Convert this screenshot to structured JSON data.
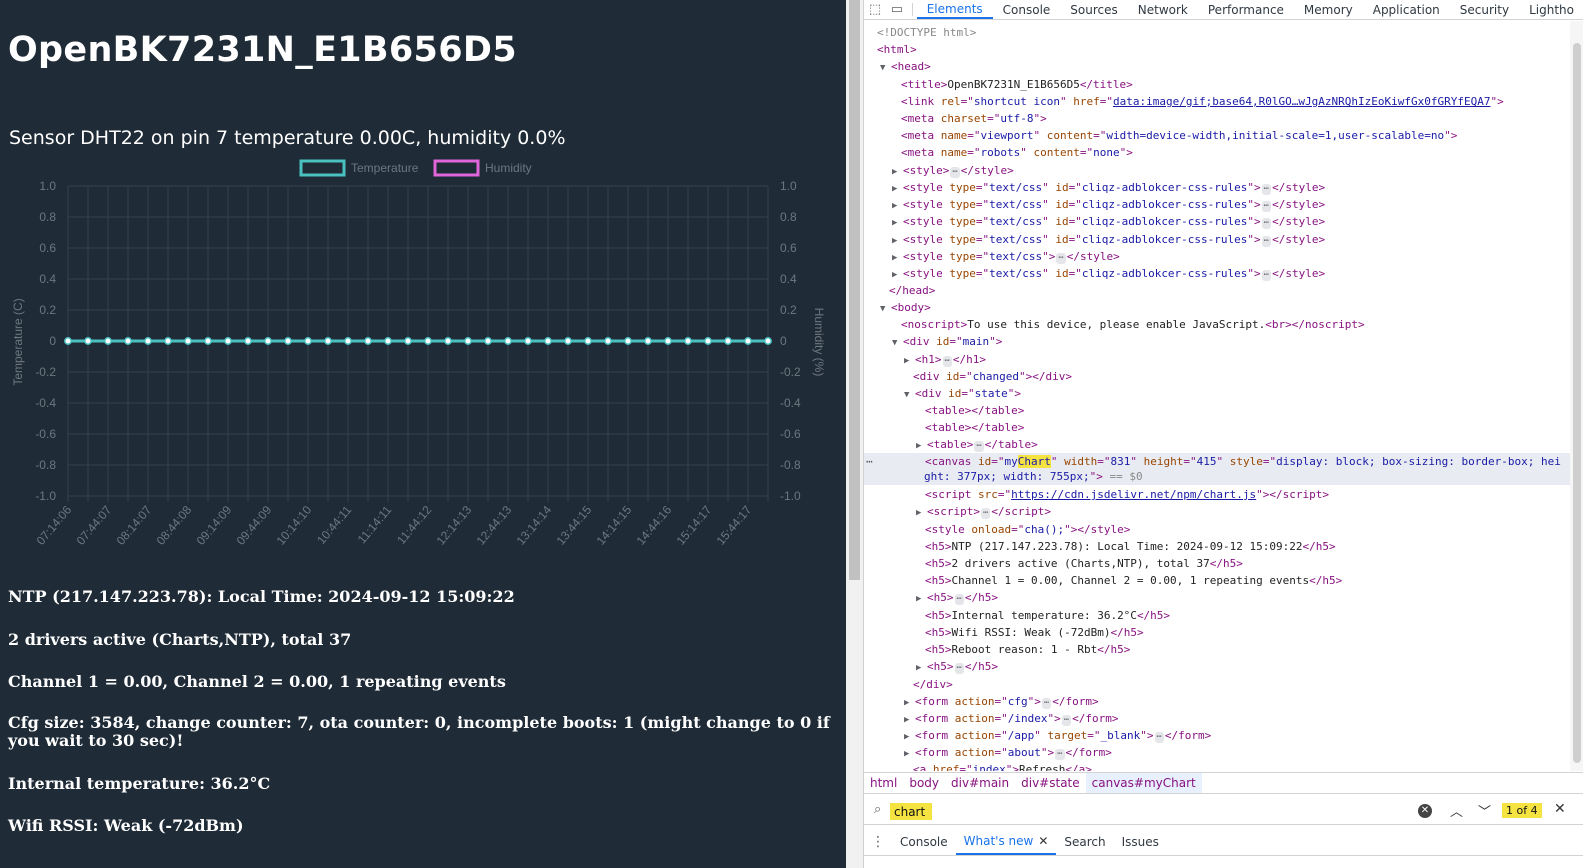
{
  "page": {
    "title": "OpenBK7231N_E1B656D5",
    "chart_heading": "Sensor DHT22 on pin 7 temperature 0.00C, humidity 0.0%",
    "info_lines": [
      "NTP (217.147.223.78): Local Time: 2024-09-12 15:09:22",
      "2 drivers active (Charts,NTP), total 37",
      "Channel 1 = 0.00, Channel 2 = 0.00, 1 repeating events",
      "Cfg size: 3584, change counter: 7, ota counter: 0, incomplete boots: 1 (might change to 0 if you wait to 30 sec)!",
      "Internal temperature: 36.2°C",
      "Wifi RSSI: Weak (-72dBm)"
    ]
  },
  "chart_data": {
    "type": "line",
    "title": "",
    "categories": [
      "07:14:06",
      "07:44:07",
      "08:14:07",
      "08:44:08",
      "09:14:09",
      "09:44:09",
      "10:14:10",
      "10:44:11",
      "11:14:11",
      "11:44:12",
      "12:14:13",
      "12:44:13",
      "13:14:14",
      "13:44:15",
      "14:14:15",
      "14:44:16",
      "15:14:17",
      "15:44:17"
    ],
    "points_per_series": 36,
    "series": [
      {
        "name": "Temperature",
        "color": "#4bc0c0",
        "value": 0,
        "axis": "left"
      },
      {
        "name": "Humidity",
        "color": "#e066d9",
        "value": 0,
        "axis": "right"
      }
    ],
    "ylabel": "Temperature (C)",
    "y2label": "Humidity (%)",
    "ylim": [
      -1.0,
      1.0
    ],
    "y2lim": [
      -1.0,
      1.0
    ],
    "yticks": [
      "1.0",
      "0.8",
      "0.6",
      "0.4",
      "0.2",
      "0",
      "-0.2",
      "-0.4",
      "-0.6",
      "-0.8",
      "-1.0"
    ],
    "grid": true,
    "legend": "top-center"
  },
  "devtools": {
    "tabs": [
      "Elements",
      "Console",
      "Sources",
      "Network",
      "Performance",
      "Memory",
      "Application",
      "Security",
      "Lightho"
    ],
    "active_tab": "Elements",
    "breadcrumbs": [
      "html",
      "body",
      "div#main",
      "div#state",
      "canvas#myChart"
    ],
    "search": {
      "value": "chart",
      "match": "1 of 4"
    },
    "drawer_tabs": [
      "Console",
      "What's new",
      "Search",
      "Issues"
    ],
    "dom": {
      "doctype": "<!DOCTYPE html>",
      "title_text": "OpenBK7231N_E1B656D5",
      "link_href": "data:image/gif;base64,R0lGO…wJgAzNRQhIzEoKiwfGx0fGRYfEQA7",
      "link_rel": "shortcut icon",
      "meta_charset": "utf-8",
      "meta_viewport": "width=device-width,initial-scale=1,user-scalable=no",
      "meta_robots": "none",
      "css_type": "text/css",
      "cliqz_id": "cliqz-adblokcer-css-rules",
      "noscript_text": "To use this device, please enable JavaScript.",
      "main_id": "main",
      "changed_id": "changed",
      "state_id": "state",
      "canvas_id_pre": "my",
      "canvas_id_hl": "Chart",
      "canvas_width": "831",
      "canvas_height": "415",
      "canvas_style_1": "display: block; box-sizing: border-box; hei",
      "canvas_style_2": "ght: 377px; width: 755px;",
      "eq0": "== $0",
      "script_src": "https://cdn.jsdelivr.net/npm/chart.js",
      "style_onload": "cha();",
      "h5_ntp": "NTP (217.147.223.78): Local Time: 2024-09-12 15:09:22",
      "h5_drivers": "2 drivers active (Charts,NTP), total 37",
      "h5_channels": "Channel 1 = 0.00, Channel 2 = 0.00, 1 repeating events",
      "h5_temp": "Internal temperature: 36.2°C",
      "h5_wifi": "Wifi RSSI: Weak (-72dBm)",
      "h5_reboot": "Reboot reason: 1 - Rbt",
      "form_cfg": "cfg",
      "form_index": "/index",
      "form_app": "/app",
      "form_target": "_blank",
      "form_about": "about",
      "a_href": "index",
      "a_text": "Refresh"
    }
  }
}
